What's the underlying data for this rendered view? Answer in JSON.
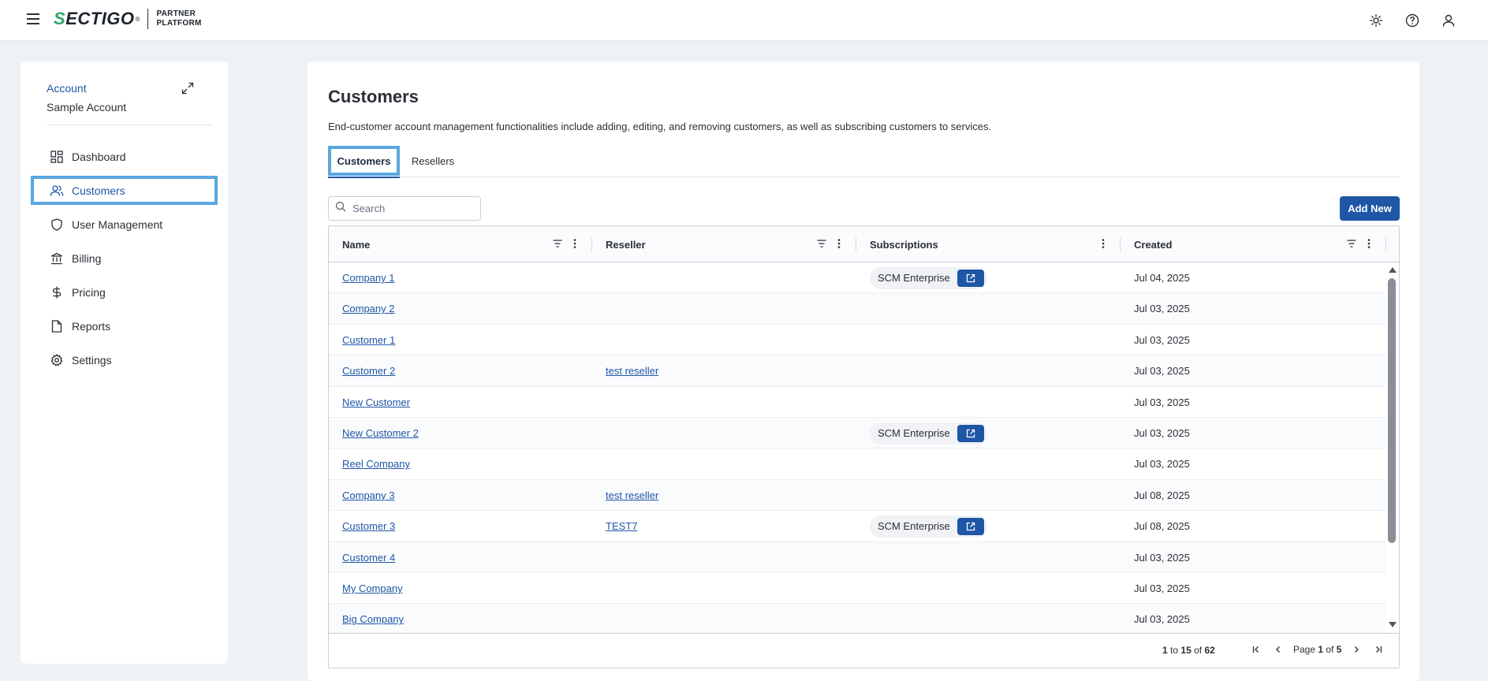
{
  "brand": {
    "wordmark_s": "S",
    "wordmark_rest": "ECTIGO",
    "reg": "®",
    "sub_line1": "PARTNER",
    "sub_line2": "PLATFORM",
    "accent": "#2ea86a"
  },
  "sidebar": {
    "account_label": "Account",
    "account_name": "Sample Account",
    "items": [
      {
        "label": "Dashboard",
        "icon": "dashboard-icon"
      },
      {
        "label": "Customers",
        "icon": "users-icon",
        "active": true
      },
      {
        "label": "User Management",
        "icon": "shield-icon"
      },
      {
        "label": "Billing",
        "icon": "bank-icon"
      },
      {
        "label": "Pricing",
        "icon": "dollar-icon"
      },
      {
        "label": "Reports",
        "icon": "document-icon"
      },
      {
        "label": "Settings",
        "icon": "gear-icon"
      }
    ]
  },
  "main": {
    "title": "Customers",
    "description": "End-customer account management functionalities include adding, editing, and removing customers, as well as subscribing customers to services.",
    "tabs": [
      {
        "label": "Customers",
        "active": true
      },
      {
        "label": "Resellers"
      }
    ],
    "search_placeholder": "Search",
    "add_button": "Add New"
  },
  "table": {
    "columns": [
      "Name",
      "Reseller",
      "Subscriptions",
      "Created"
    ],
    "rows": [
      {
        "name": "Company  1",
        "reseller": "",
        "subscription": "SCM Enterprise",
        "created": "Jul 04, 2025"
      },
      {
        "name": "Company 2",
        "reseller": "",
        "subscription": "",
        "created": "Jul 03, 2025"
      },
      {
        "name": "Customer 1",
        "reseller": "",
        "subscription": "",
        "created": "Jul 03, 2025"
      },
      {
        "name": "Customer 2",
        "reseller": "test reseller",
        "subscription": "",
        "created": "Jul 03, 2025"
      },
      {
        "name": "New Customer",
        "reseller": "",
        "subscription": "",
        "created": "Jul 03, 2025"
      },
      {
        "name": "New Customer 2",
        "reseller": "",
        "subscription": "SCM Enterprise",
        "created": "Jul 03, 2025"
      },
      {
        "name": "Reel Company",
        "reseller": "",
        "subscription": "",
        "created": "Jul 03, 2025"
      },
      {
        "name": "Company 3",
        "reseller": "test reseller",
        "subscription": "",
        "created": "Jul 08, 2025"
      },
      {
        "name": "Customer 3",
        "reseller": "TEST7",
        "subscription": "SCM Enterprise",
        "created": "Jul 08, 2025"
      },
      {
        "name": "Customer 4",
        "reseller": "",
        "subscription": "",
        "created": "Jul 03, 2025"
      },
      {
        "name": "My Company",
        "reseller": "",
        "subscription": "",
        "created": "Jul 03, 2025"
      },
      {
        "name": "Big Company",
        "reseller": "",
        "subscription": "",
        "created": "Jul 03, 2025"
      }
    ],
    "footer": {
      "from": "1",
      "to_word": "to",
      "to": "15",
      "of_word": "of",
      "total": "62",
      "page_word": "Page",
      "page": "1",
      "page_of_word": "of",
      "pages": "5"
    }
  },
  "colors": {
    "primary": "#1f56a6",
    "highlight": "#5aa7df"
  }
}
